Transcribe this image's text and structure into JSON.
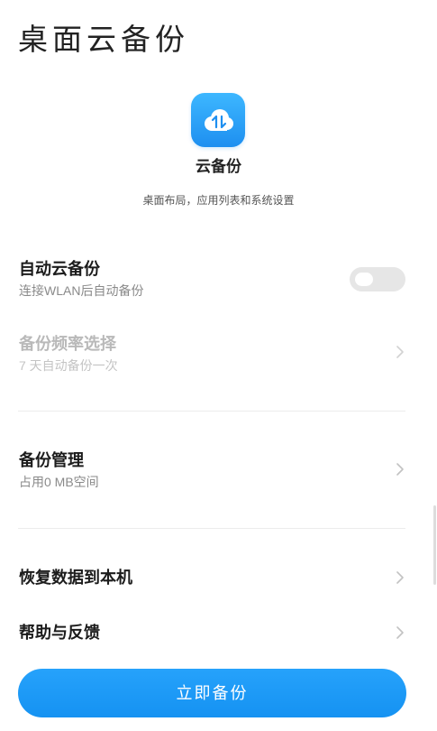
{
  "page": {
    "title": "桌面云备份"
  },
  "hero": {
    "icon": "cloud-sync-icon",
    "name": "云备份",
    "description": "桌面布局，应用列表和系统设置"
  },
  "settings": {
    "auto_backup": {
      "title": "自动云备份",
      "subtitle": "连接WLAN后自动备份",
      "toggle_on": false
    },
    "frequency": {
      "title": "备份频率选择",
      "subtitle": "7 天自动备份一次",
      "enabled": false,
      "icon": "chevron-right-icon"
    },
    "manage": {
      "title": "备份管理",
      "subtitle": "占用0 MB空间",
      "icon": "chevron-right-icon"
    },
    "restore": {
      "title": "恢复数据到本机",
      "icon": "chevron-right-icon"
    },
    "help": {
      "title": "帮助与反馈",
      "icon": "chevron-right-icon"
    }
  },
  "actions": {
    "backup_now_label": "立即备份"
  },
  "colors": {
    "accent": "#1a98f5",
    "text": "#1c1c1c",
    "subtext": "#8a8a8a",
    "disabled_text": "#b9b9b9",
    "toggle_off": "#e6e6e6"
  }
}
